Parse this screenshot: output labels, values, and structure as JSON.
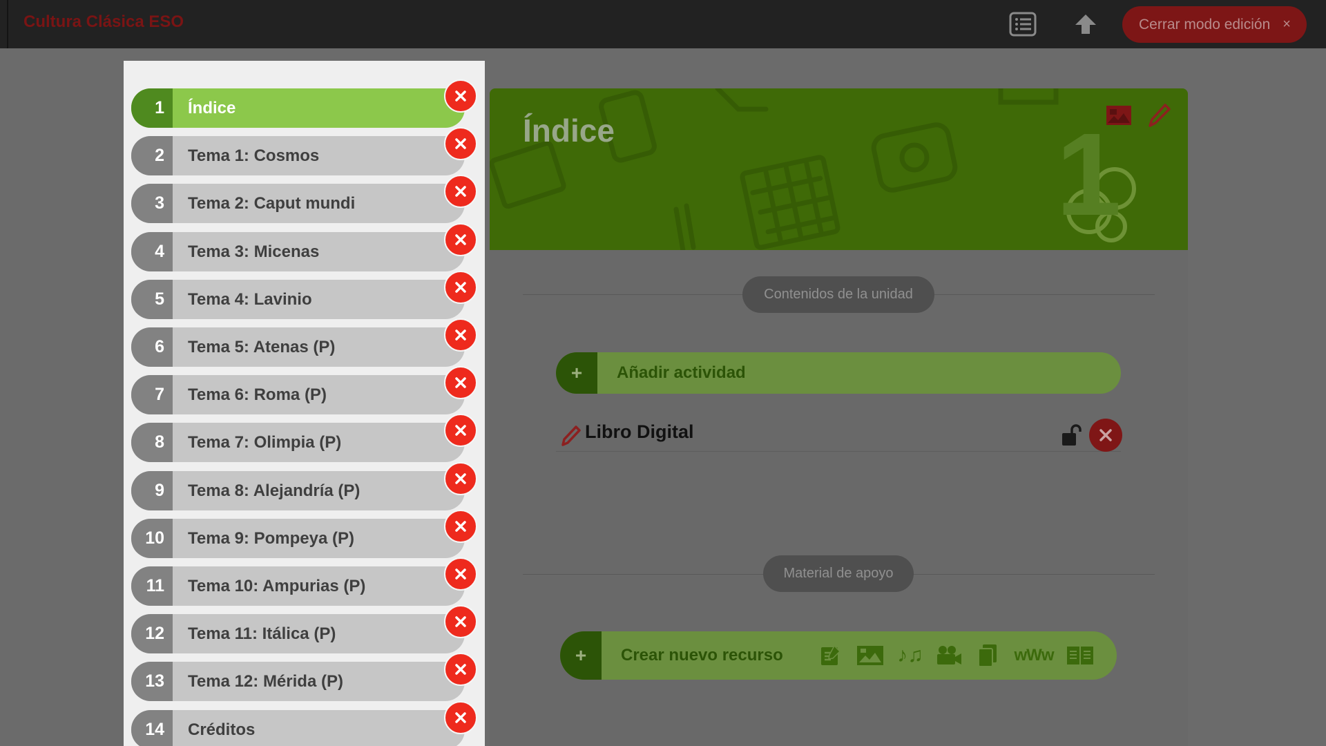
{
  "header": {
    "app_title": "Cultura Clásica ESO",
    "close_edit_label": "Cerrar modo edición",
    "close_edit_x": "×"
  },
  "sidebar": {
    "items": [
      {
        "num": "1",
        "label": "Índice",
        "active": true
      },
      {
        "num": "2",
        "label": "Tema 1: Cosmos"
      },
      {
        "num": "3",
        "label": "Tema 2: Caput mundi"
      },
      {
        "num": "4",
        "label": "Tema 3: Micenas"
      },
      {
        "num": "5",
        "label": "Tema 4: Lavinio"
      },
      {
        "num": "6",
        "label": "Tema 5: Atenas (P)"
      },
      {
        "num": "7",
        "label": "Tema 6: Roma (P)"
      },
      {
        "num": "8",
        "label": "Tema 7: Olimpia (P)"
      },
      {
        "num": "9",
        "label": "Tema 8: Alejandría (P)"
      },
      {
        "num": "10",
        "label": "Tema 9: Pompeya (P)"
      },
      {
        "num": "11",
        "label": "Tema 10: Ampurias (P)"
      },
      {
        "num": "12",
        "label": "Tema 11: Itálica (P)"
      },
      {
        "num": "13",
        "label": "Tema 12: Mérida (P)"
      },
      {
        "num": "14",
        "label": "Créditos"
      }
    ]
  },
  "main": {
    "banner_title": "Índice",
    "banner_number": "1",
    "contents_label": "Contenidos de la unidad",
    "add_activity": {
      "plus": "+",
      "label": "Añadir actividad"
    },
    "book_label": "Libro Digital",
    "support_label": "Material de apoyo",
    "create_resource": {
      "plus": "+",
      "label": "Crear nuevo recurso",
      "icons": [
        "document-icon",
        "image-icon",
        "music-icon",
        "video-icon",
        "copy-icon",
        "web-icon",
        "book-icon"
      ],
      "www_text": "wWw",
      "music_text": "♪♫"
    }
  },
  "colors": {
    "topbar": "#222222",
    "overlay": "#6b6b6b",
    "sidebar_bg": "#efefef",
    "active_green": "#8cc84b",
    "active_num_green": "#4f8a1f",
    "delete_red": "#ee2a1d",
    "banner_green": "#3f6a07"
  }
}
